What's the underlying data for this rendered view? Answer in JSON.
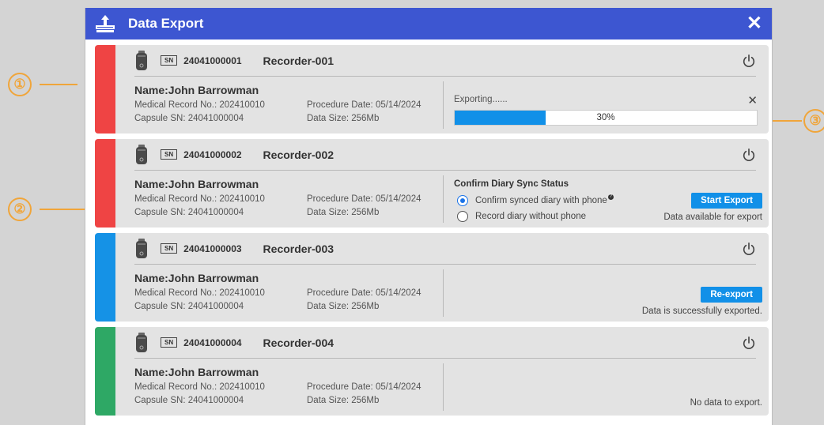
{
  "dialog": {
    "title": "Data Export",
    "close_label": "✕"
  },
  "callouts": [
    "①",
    "②",
    "③"
  ],
  "labels": {
    "sn_badge": "SN",
    "medical_record": "Medical Record No.: ",
    "procedure_date": "Procedure Date: ",
    "capsule_sn": "Capsule SN: ",
    "data_size": "Data Size: "
  },
  "recorders": [
    {
      "status_color": "#ef4444",
      "sn": "24041000001",
      "name": "Recorder-001",
      "patient": "Name:John Barrowman",
      "medical_record_no": "202410010",
      "procedure_date": "05/14/2024",
      "capsule_sn": "24041000004",
      "data_size": "256Mb",
      "state": "exporting",
      "exporting_label": "Exporting......",
      "progress_percent": 30,
      "progress_text": "30%",
      "cancel_label": "✕"
    },
    {
      "status_color": "#ef4444",
      "sn": "24041000002",
      "name": "Recorder-002",
      "patient": "Name:John Barrowman",
      "medical_record_no": "202410010",
      "procedure_date": "05/14/2024",
      "capsule_sn": "24041000004",
      "data_size": "256Mb",
      "state": "ready",
      "sync_title": "Confirm Diary Sync Status",
      "option_1": "Confirm synced diary with phone",
      "option_2": "Record diary without phone",
      "selected_option": 1,
      "help_glyph": "?",
      "button_label": "Start Export",
      "status_text": "Data available for export"
    },
    {
      "status_color": "#1592e6",
      "sn": "24041000003",
      "name": "Recorder-003",
      "patient": "Name:John Barrowman",
      "medical_record_no": "202410010",
      "procedure_date": "05/14/2024",
      "capsule_sn": "24041000004",
      "data_size": "256Mb",
      "state": "exported",
      "button_label": "Re-export",
      "status_text": "Data is successfully exported."
    },
    {
      "status_color": "#2ea865",
      "sn": "24041000004",
      "name": "Recorder-004",
      "patient": "Name:John Barrowman",
      "medical_record_no": "202410010",
      "procedure_date": "05/14/2024",
      "capsule_sn": "24041000004",
      "data_size": "256Mb",
      "state": "empty",
      "status_text": "No data to export."
    }
  ]
}
